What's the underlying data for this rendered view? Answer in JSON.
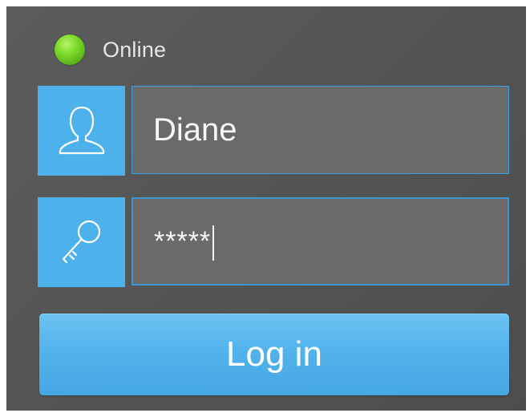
{
  "status": {
    "label": "Online",
    "indicator_color": "#7fdc2c"
  },
  "username": {
    "icon": "user-icon",
    "value": "Diane"
  },
  "password": {
    "icon": "key-icon",
    "value": "*****"
  },
  "login_button": {
    "label": "Log in"
  },
  "colors": {
    "accent": "#4db2ec",
    "background": "#575757",
    "field": "#6a6a6a"
  }
}
